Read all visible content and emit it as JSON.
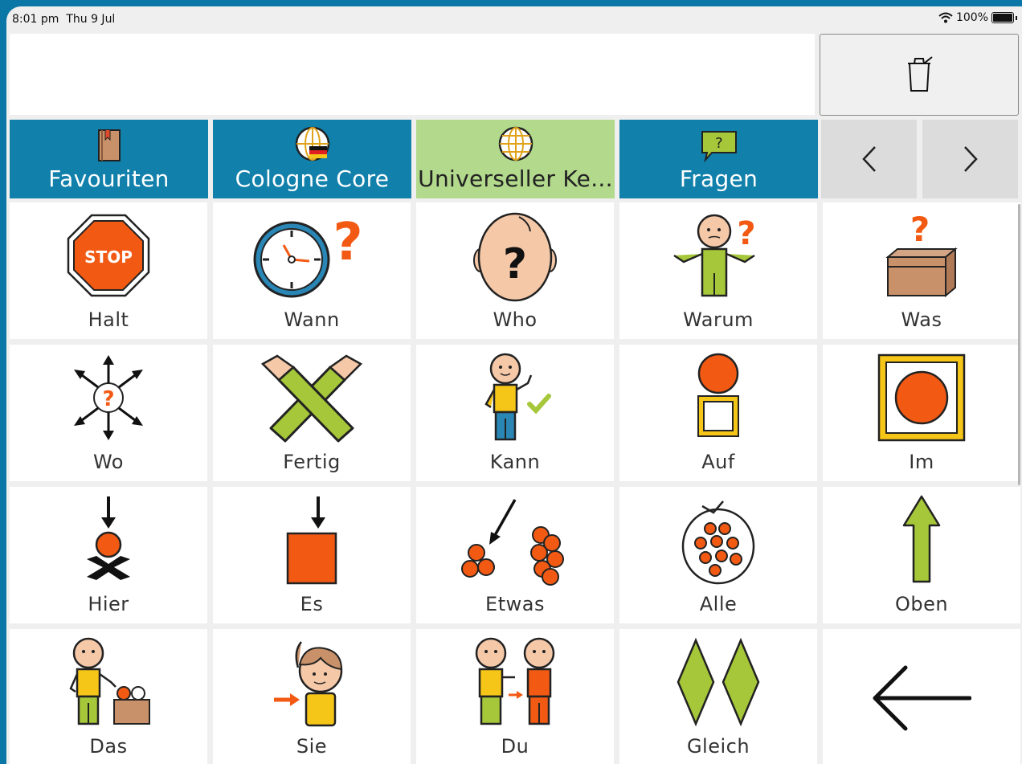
{
  "status": {
    "time": "8:01 pm",
    "date": "Thu 9 Jul",
    "battery": "100%"
  },
  "message_bar": {
    "text": ""
  },
  "tabs": [
    {
      "label": "Favouriten",
      "icon": "book-icon",
      "active": false
    },
    {
      "label": "Cologne Core",
      "icon": "globe-germany-icon",
      "active": false
    },
    {
      "label": "Universeller Ke...",
      "icon": "globe-icon",
      "active": true
    },
    {
      "label": "Fragen",
      "icon": "question-bubble-icon",
      "active": false
    }
  ],
  "nav": {
    "prev": "chevron-left-icon",
    "next": "chevron-right-icon"
  },
  "grid": [
    [
      "Halt",
      "Wann",
      "Who",
      "Warum",
      "Was"
    ],
    [
      "Wo",
      "Fertig",
      "Kann",
      "Auf",
      "Im"
    ],
    [
      "Hier",
      "Es",
      "Etwas",
      "Alle",
      "Oben"
    ],
    [
      "Das",
      "Sie",
      "Du",
      "Gleich",
      ""
    ]
  ],
  "colors": {
    "frame": "#0a77a6",
    "tab": "#1180ab",
    "tab_active": "#b2d98c",
    "symbol_orange": "#f25a14",
    "symbol_green": "#a5c739"
  }
}
